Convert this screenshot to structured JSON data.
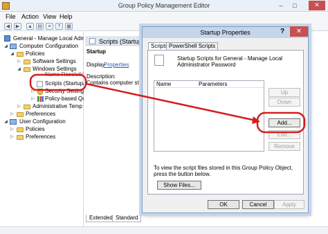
{
  "window": {
    "title": "Group Policy Management Editor"
  },
  "menu": [
    "File",
    "Action",
    "View",
    "Help"
  ],
  "tree": {
    "items": [
      "General - Manage Local Admini",
      "Computer Configuration",
      "Policies",
      "Software Settings",
      "Windows Settings",
      "Name Resolution",
      "Scripts (Startup/S",
      "Security Settings",
      "Policy-based QoS",
      "Administrative Temp",
      "Preferences",
      "User Configuration",
      "Policies",
      "Preferences"
    ]
  },
  "pane": {
    "header": "Scripts (Startup/",
    "title": "Startup",
    "display_prefix": "Display",
    "display_link": "Properties",
    "desc_label": "Description:",
    "desc_text": "Contains computer startu"
  },
  "bottom_tabs": [
    "Extended",
    "Standard"
  ],
  "dialog": {
    "title": "Startup Properties",
    "help": "?",
    "close": "✕",
    "tabs": [
      "Scripts",
      "PowerShell Scripts"
    ],
    "description": "Startup Scripts for General - Manage Local Administrator Password",
    "columns": [
      "Name",
      "Parameters"
    ],
    "side_buttons": [
      "Up",
      "Down",
      "Add...",
      "Edit...",
      "Remove"
    ],
    "info": "To view the script files stored in this Group Policy Object, press the button below.",
    "show_files": "Show Files...",
    "ok": "OK",
    "cancel": "Cancel",
    "apply": "Apply"
  },
  "colors": {
    "annotation": "#d61d1d",
    "accent": "#c6d6ea",
    "close": "#c75050"
  }
}
